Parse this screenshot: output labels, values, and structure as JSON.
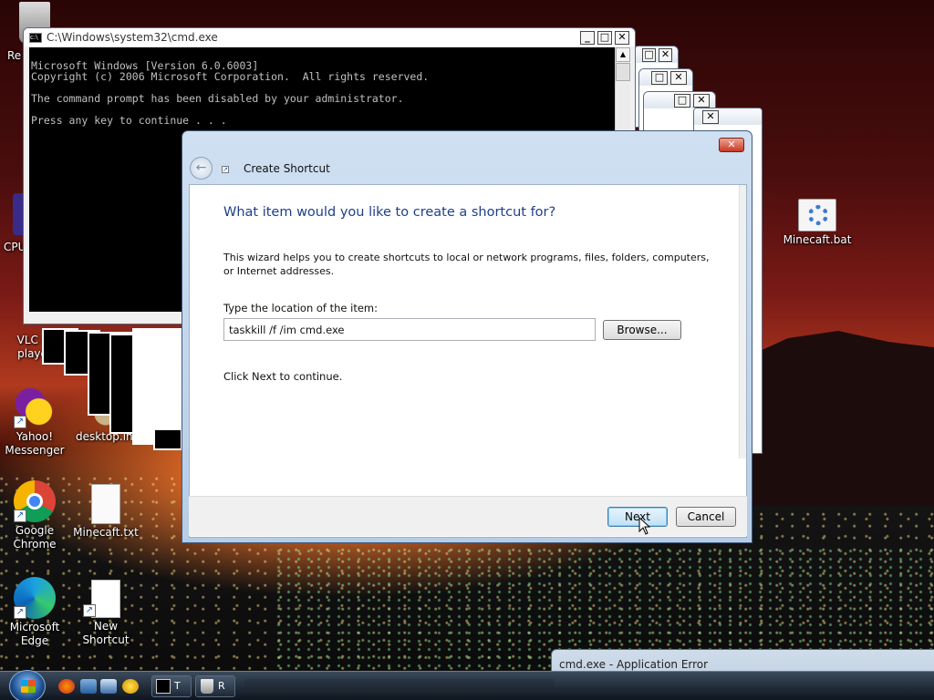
{
  "desktop": {
    "icons": [
      {
        "label": "Re"
      },
      {
        "label": "CPU"
      },
      {
        "label": "VLC m\nplayer"
      },
      {
        "label": "Yahoo!\nMessenger"
      },
      {
        "label": "desktop.ini"
      },
      {
        "label": "Google\nChrome"
      },
      {
        "label": "Minecaft.txt"
      },
      {
        "label": "Microsoft\nEdge"
      },
      {
        "label": "New Shortcut"
      },
      {
        "label": "Minecaft.bat"
      }
    ]
  },
  "cmd_window": {
    "title": "C:\\Windows\\system32\\cmd.exe",
    "lines": [
      "Microsoft Windows [Version 6.0.6003]",
      "Copyright (c) 2006 Microsoft Corporation.  All rights reserved.",
      "",
      "The command prompt has been disabled by your administrator.",
      "",
      "Press any key to continue . . ."
    ]
  },
  "wizard": {
    "title": "Create Shortcut",
    "heading": "What item would you like to create a shortcut for?",
    "description": "This wizard helps you to create shortcuts to local or network programs, files, folders, computers, or Internet addresses.",
    "location_label": "Type the location of the item:",
    "location_value": "taskkill /f /im cmd.exe",
    "browse_label": "Browse...",
    "continue_hint": "Click Next to continue.",
    "next_label": "Next",
    "cancel_label": "Cancel"
  },
  "error_window": {
    "title": "cmd.exe - Application Error"
  },
  "taskbar": {
    "buttons": [
      {
        "label": "T"
      },
      {
        "label": "R"
      }
    ]
  }
}
